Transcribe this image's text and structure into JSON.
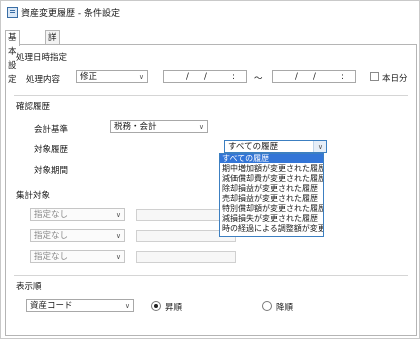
{
  "window": {
    "title": "資産変更履歴 - 条件設定"
  },
  "tabs": [
    {
      "label": "基本設定",
      "active": true
    },
    {
      "label": "詳細設定",
      "active": false
    }
  ],
  "processing_date": {
    "section_label": "処理日時指定",
    "content_label": "処理内容",
    "content_value": "修正",
    "date_from": {
      "slash1": "/",
      "slash2": "/",
      "colon": ":"
    },
    "tilde": "〜",
    "date_to": {
      "slash1": "/",
      "slash2": "/",
      "colon": ":"
    },
    "own_only_label": "本日分",
    "own_only_checked": false
  },
  "history": {
    "section_label": "確認履歴",
    "standard_label": "会計基準",
    "standard_value": "税務・会計",
    "target_label": "対象履歴",
    "target_value": "すべての履歴",
    "period_label": "対象期間",
    "options": [
      "すべての履歴",
      "期中増加額が変更された履歴",
      "減価償却費が変更された履歴",
      "除却損益が変更された履歴",
      "売却損益が変更された履歴",
      "特別償却額が変更された履歴",
      "減損損失が変更された履歴",
      "時の経過による調整額が変更された履歴"
    ],
    "selected_index": 0
  },
  "aggregate": {
    "section_label": "集計対象",
    "rows": [
      "指定なし",
      "指定なし",
      "指定なし"
    ]
  },
  "order": {
    "section_label": "表示順",
    "sort_value": "資産コード",
    "asc_label": "昇順",
    "desc_label": "降順",
    "selected": "asc"
  },
  "colors": {
    "accent": "#3375d7",
    "focus_border": "#3c7fc1"
  }
}
